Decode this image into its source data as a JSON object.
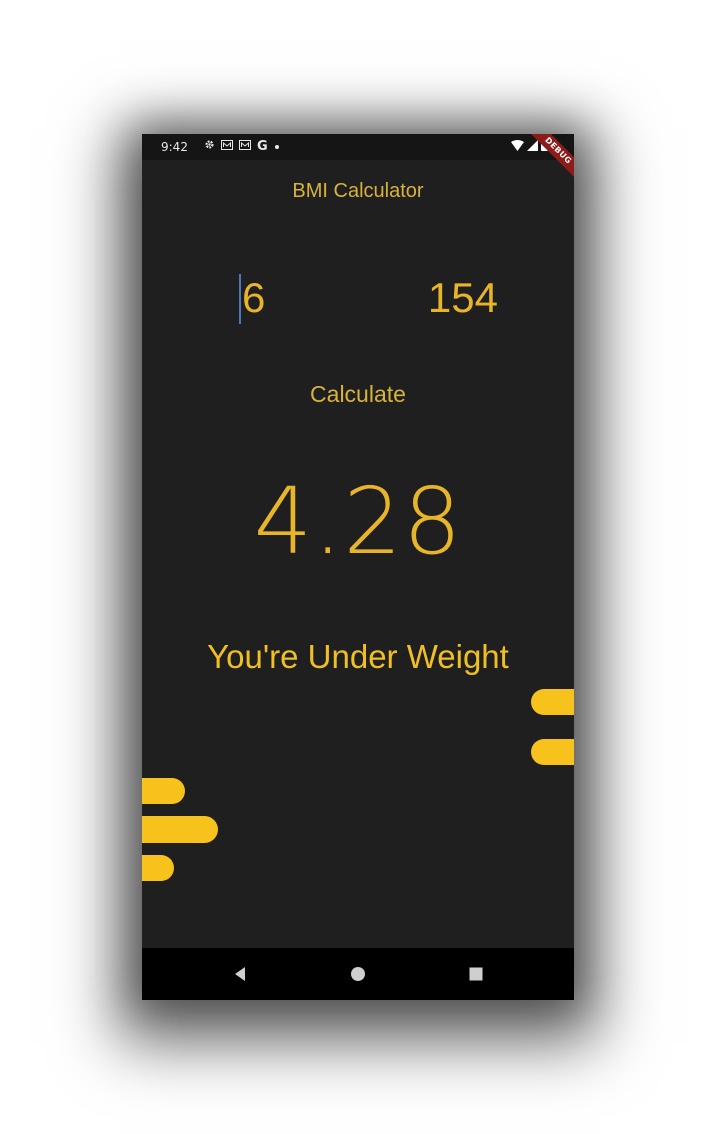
{
  "status_bar": {
    "time": "9:42",
    "left_icons": [
      "settings-icon",
      "notification-icon",
      "notification-icon",
      "google-icon",
      "dot-icon"
    ],
    "right_icons": [
      "wifi-icon",
      "signal-icon",
      "battery-icon"
    ],
    "debug_banner": "DEBUG"
  },
  "app": {
    "title": "BMI Calculator"
  },
  "inputs": {
    "height_value": "6",
    "weight_value": "154"
  },
  "actions": {
    "calculate_label": "Calculate"
  },
  "result": {
    "bmi_value": "4.28",
    "message": "You're Under Weight"
  },
  "navigation": {
    "back": "back-icon",
    "home": "home-icon",
    "recents": "recents-icon"
  },
  "colors": {
    "background": "#1f1f1f",
    "accent": "#f7c21b",
    "text_accent": "#e8b42a",
    "cursor": "#4a79b5",
    "debug_banner": "#8e1b1b"
  }
}
